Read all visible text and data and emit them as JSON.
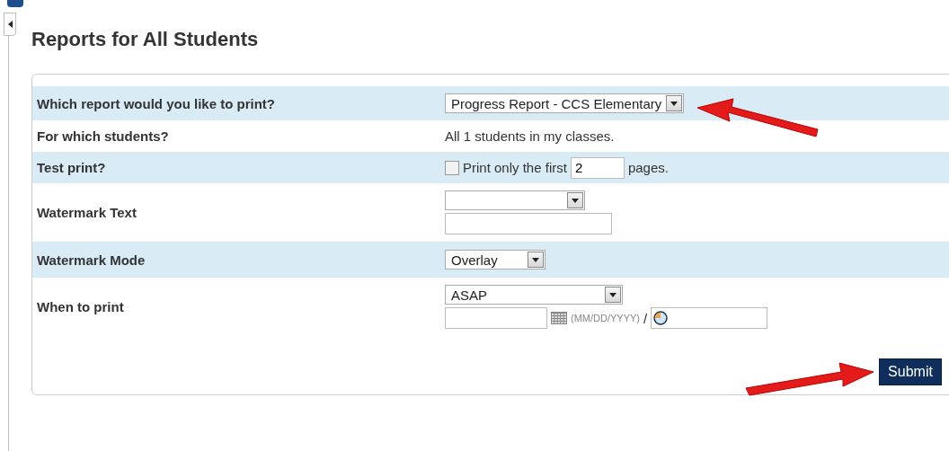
{
  "title": "Reports for All Students",
  "rows": [
    {
      "label": "Which report would you like to print?",
      "kind": "select",
      "shaded": true,
      "select": {
        "value": "Progress Report - CCS Elementary"
      }
    },
    {
      "label": "For which students?",
      "kind": "text",
      "shaded": false,
      "text": "All 1 students in my classes."
    },
    {
      "label": "Test print?",
      "kind": "test_print",
      "shaded": true,
      "checked": false,
      "before": "Print only the first",
      "value": "2",
      "after": "pages."
    },
    {
      "label": "Watermark Text",
      "kind": "select_input",
      "shaded": false
    },
    {
      "label": "Watermark Mode",
      "kind": "select",
      "shaded": true,
      "select": {
        "value": "Overlay"
      }
    },
    {
      "label": "When to print",
      "kind": "schedule",
      "shaded": false,
      "select": {
        "value": "ASAP"
      },
      "date_hint": "(MM/DD/YYYY)",
      "separator": "/"
    }
  ],
  "submit": "Submit"
}
